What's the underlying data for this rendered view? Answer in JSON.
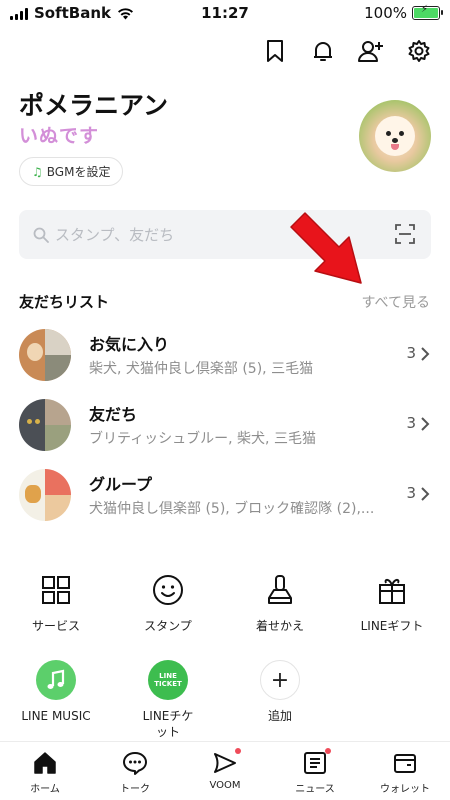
{
  "status_bar": {
    "carrier": "SoftBank",
    "time": "11:27",
    "battery": "100%",
    "battery_level": 1.0
  },
  "top_icons": [
    "bookmark-icon",
    "bell-icon",
    "add-friend-icon",
    "settings-icon"
  ],
  "profile": {
    "name": "ポメラニアン",
    "status_message": "いぬです",
    "bgm_label": "BGMを設定"
  },
  "search": {
    "placeholder": "スタンプ、友だち"
  },
  "friends_section": {
    "title": "友だちリスト",
    "see_all": "すべて見る",
    "items": [
      {
        "name": "お気に入り",
        "sub": "柴犬, 犬猫仲良し倶楽部 (5), 三毛猫",
        "count": "3"
      },
      {
        "name": "友だち",
        "sub": "ブリティッシュブルー, 柴犬, 三毛猫",
        "count": "3"
      },
      {
        "name": "グループ",
        "sub": "犬猫仲良し倶楽部 (5), ブロック確認隊 (2),...",
        "count": "3"
      }
    ]
  },
  "services": [
    {
      "label": "サービス",
      "icon": "grid-icon"
    },
    {
      "label": "スタンプ",
      "icon": "smiley-icon"
    },
    {
      "label": "着せかえ",
      "icon": "brush-icon"
    },
    {
      "label": "LINEギフト",
      "icon": "gift-icon"
    },
    {
      "label": "LINE MUSIC",
      "icon": "music-icon"
    },
    {
      "label": "LINEチケット",
      "icon": "ticket-icon",
      "badge_line1": "LINE",
      "badge_line2": "TICKET"
    },
    {
      "label": "追加",
      "icon": "plus-icon"
    }
  ],
  "bottom_nav": [
    {
      "label": "ホーム",
      "icon": "home-icon"
    },
    {
      "label": "トーク",
      "icon": "talk-icon"
    },
    {
      "label": "VOOM",
      "icon": "voom-icon"
    },
    {
      "label": "ニュース",
      "icon": "news-icon"
    },
    {
      "label": "ウォレット",
      "icon": "wallet-icon"
    }
  ],
  "colors": {
    "accent_green": "#3dbd4f",
    "arrow_red": "#e8141b",
    "badge_red": "#ef4b59"
  }
}
